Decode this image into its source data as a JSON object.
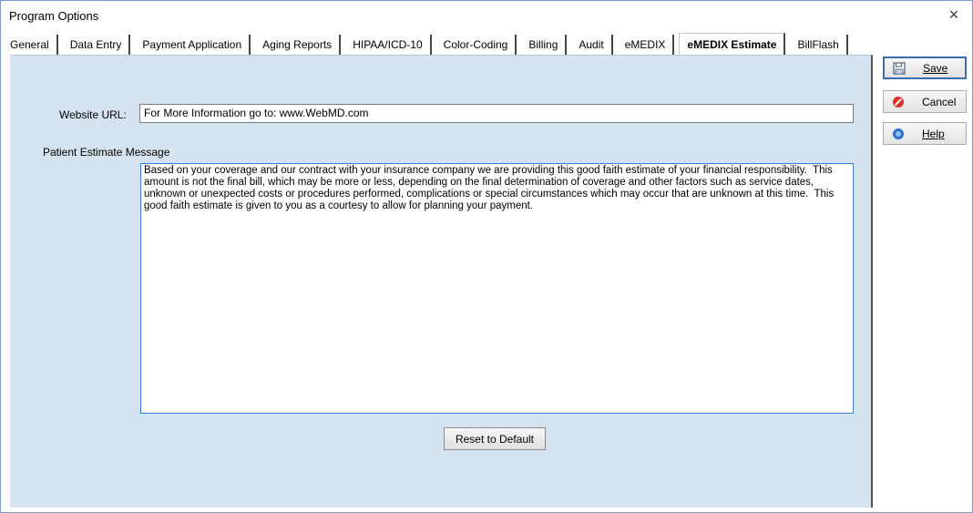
{
  "window": {
    "title": "Program Options",
    "close_glyph": "×"
  },
  "tabs": [
    {
      "label": "General",
      "active": false
    },
    {
      "label": "Data Entry",
      "active": false
    },
    {
      "label": "Payment Application",
      "active": false
    },
    {
      "label": "Aging Reports",
      "active": false
    },
    {
      "label": "HIPAA/ICD-10",
      "active": false
    },
    {
      "label": "Color-Coding",
      "active": false
    },
    {
      "label": "Billing",
      "active": false
    },
    {
      "label": "Audit",
      "active": false
    },
    {
      "label": "eMEDIX",
      "active": false
    },
    {
      "label": "eMEDIX Estimate",
      "active": true
    },
    {
      "label": "BillFlash",
      "active": false
    }
  ],
  "form": {
    "website_url_label": "Website URL:",
    "website_url_value": "For More Information go to:  www.WebMD.com",
    "message_label": "Patient Estimate Message",
    "message_value": "Based on your coverage and our contract with your insurance company we are providing this good faith estimate of your financial responsibility.  This amount is not the final bill, which may be more or less, depending on the final determination of coverage and other factors such as service dates, unknown or unexpected costs or procedures performed, complications or special circumstances which may occur that are unknown at this time.  This good faith estimate is given to you as a courtesy to allow for planning your payment.",
    "reset_label": "Reset to Default"
  },
  "actions": {
    "save_label": "Save",
    "cancel_label": "Cancel",
    "help_label": "Help",
    "save_icon": "floppy-disk-icon",
    "cancel_icon": "cancel-icon",
    "help_icon": "help-icon"
  },
  "colors": {
    "panel_bg": "#d5e2f0",
    "focus_border": "#3d7dd3",
    "cancel_red": "#d9302c",
    "help_blue": "#2a6fc9"
  }
}
